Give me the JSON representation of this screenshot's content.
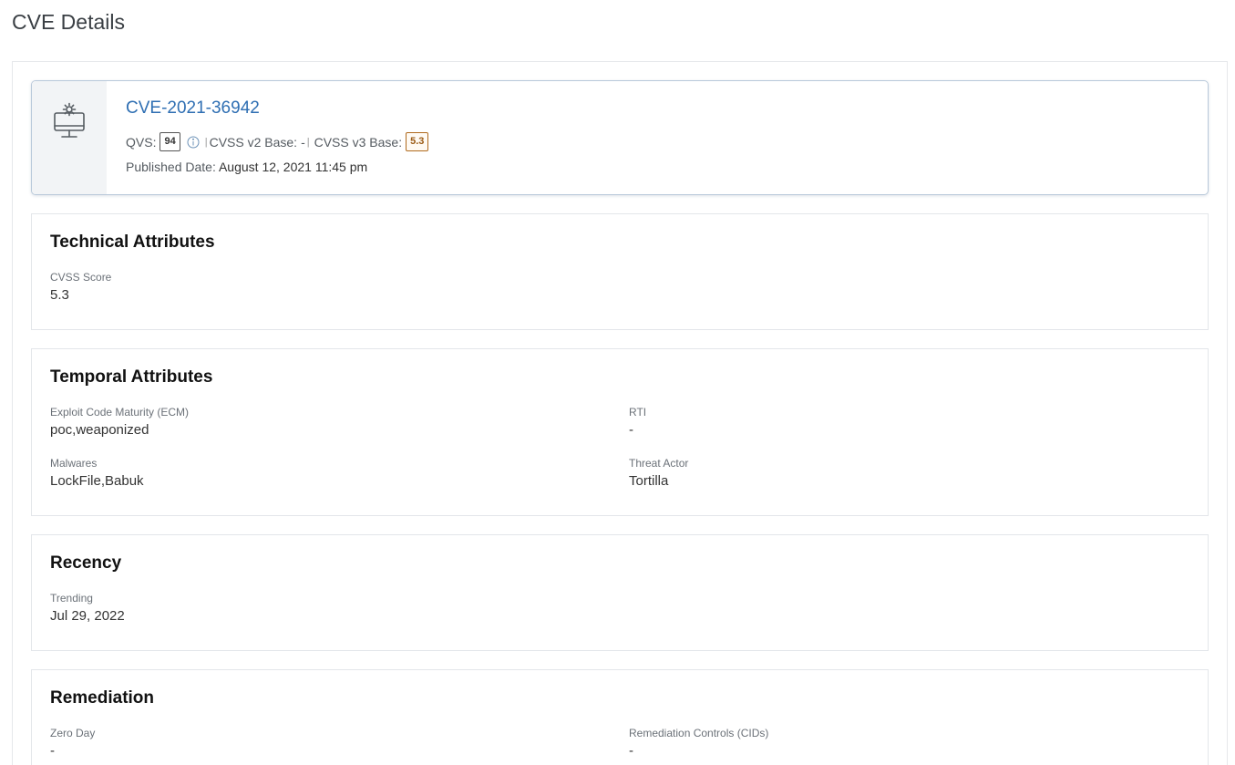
{
  "page": {
    "title": "CVE Details"
  },
  "header": {
    "icon": "monitor-gear-icon",
    "cve_id": "CVE-2021-36942",
    "qvs_label": "QVS:",
    "qvs_value": "94",
    "info_icon": "info-icon",
    "sep1": "|",
    "cvss2_label": "CVSS v2 Base:",
    "cvss2_value": "-",
    "sep2": "|",
    "cvss3_label": "CVSS v3 Base:",
    "cvss3_value": "5.3",
    "published_label": "Published Date:",
    "published_value": "August 12, 2021 11:45 pm"
  },
  "technical": {
    "title": "Technical Attributes",
    "cvss_score_label": "CVSS Score",
    "cvss_score_value": "5.3"
  },
  "temporal": {
    "title": "Temporal Attributes",
    "ecm_label": "Exploit Code Maturity (ECM)",
    "ecm_value": "poc,weaponized",
    "rti_label": "RTI",
    "rti_value": "-",
    "malwares_label": "Malwares",
    "malwares_value": "LockFile,Babuk",
    "threat_actor_label": "Threat Actor",
    "threat_actor_value": "Tortilla"
  },
  "recency": {
    "title": "Recency",
    "trending_label": "Trending",
    "trending_value": "Jul 29, 2022"
  },
  "remediation": {
    "title": "Remediation",
    "zero_day_label": "Zero Day",
    "zero_day_value": "-",
    "controls_label": "Remediation Controls (CIDs)",
    "controls_value": "-"
  },
  "colors": {
    "link": "#2f6fb3",
    "cvss3_border": "#b06a1e",
    "card_border": "#b9c9da"
  }
}
